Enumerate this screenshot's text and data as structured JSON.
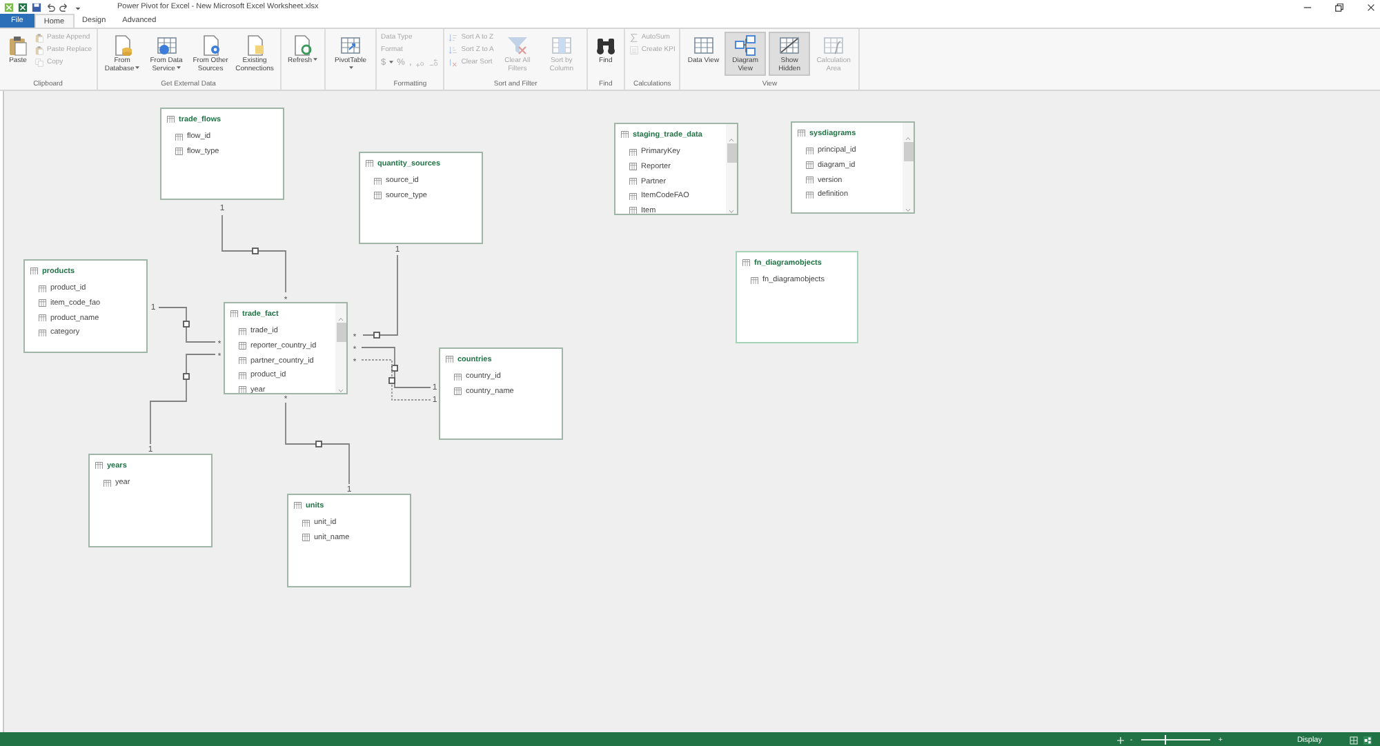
{
  "window": {
    "title": "Power Pivot for Excel - New Microsoft Excel Worksheet.xlsx"
  },
  "ribbon_tabs": [
    {
      "label": "File",
      "kind": "file",
      "selected": false
    },
    {
      "label": "Home",
      "kind": "tab",
      "selected": true
    },
    {
      "label": "Design",
      "kind": "tab",
      "selected": false
    },
    {
      "label": "Advanced",
      "kind": "tab",
      "selected": false
    }
  ],
  "ribbon_groups": [
    {
      "label": "Clipboard",
      "items": [
        {
          "kind": "large",
          "label": "Paste",
          "dropdown": false,
          "disabled": false,
          "selected": false
        },
        {
          "kind": "small",
          "label": "Paste Append",
          "dropdown": false,
          "disabled": true,
          "selected": false
        },
        {
          "kind": "small",
          "label": "Paste Replace",
          "dropdown": false,
          "disabled": true,
          "selected": false
        },
        {
          "kind": "small",
          "label": "Copy",
          "dropdown": false,
          "disabled": true,
          "selected": false
        }
      ]
    },
    {
      "label": "Get External Data",
      "items": [
        {
          "kind": "large",
          "label": "From Database",
          "dropdown": true,
          "disabled": false,
          "selected": false
        },
        {
          "kind": "large",
          "label": "From Data Service",
          "dropdown": true,
          "disabled": false,
          "selected": false
        },
        {
          "kind": "large",
          "label": "From Other Sources",
          "dropdown": false,
          "disabled": false,
          "selected": false
        },
        {
          "kind": "large",
          "label": "Existing Connections",
          "dropdown": false,
          "disabled": false,
          "selected": false
        }
      ]
    },
    {
      "items": [
        {
          "kind": "large",
          "label": "Refresh",
          "dropdown": true,
          "disabled": false,
          "selected": false
        }
      ]
    },
    {
      "items": [
        {
          "kind": "large",
          "label": "PivotTable",
          "dropdown": true,
          "disabled": false,
          "selected": false
        }
      ]
    },
    {
      "label": "Formatting",
      "items": [
        {
          "kind": "small",
          "label": "Data Type",
          "dropdown": false,
          "disabled": true,
          "selected": false
        },
        {
          "kind": "small",
          "label": "Format",
          "dropdown": false,
          "disabled": true,
          "selected": false
        },
        {
          "kind": "symbol",
          "label": "$",
          "dropdown": true,
          "disabled": true,
          "selected": false
        },
        {
          "kind": "symbol",
          "label": "%",
          "dropdown": false,
          "disabled": true,
          "selected": false
        },
        {
          "kind": "symbol",
          "label": ",",
          "dropdown": false,
          "disabled": true,
          "selected": false
        },
        {
          "kind": "icon",
          "dropdown": false,
          "disabled": true,
          "selected": false
        },
        {
          "kind": "icon",
          "dropdown": false,
          "disabled": true,
          "selected": false
        }
      ]
    },
    {
      "label": "Sort and Filter",
      "items": [
        {
          "kind": "small",
          "label": "Sort A to Z",
          "dropdown": false,
          "disabled": true,
          "selected": false
        },
        {
          "kind": "small",
          "label": "Sort Z to A",
          "dropdown": false,
          "disabled": true,
          "selected": false
        },
        {
          "kind": "small",
          "label": "Clear Sort",
          "dropdown": false,
          "disabled": true,
          "selected": false
        },
        {
          "kind": "large",
          "label": "Clear All Filters",
          "dropdown": false,
          "disabled": true,
          "selected": false
        },
        {
          "kind": "large",
          "label": "Sort by Column",
          "dropdown": false,
          "disabled": true,
          "selected": false
        }
      ]
    },
    {
      "label": "Find",
      "items": [
        {
          "kind": "large",
          "label": "Find",
          "dropdown": false,
          "disabled": false,
          "selected": false
        }
      ]
    },
    {
      "label": "Calculations",
      "items": [
        {
          "kind": "small",
          "label": "AutoSum",
          "dropdown": false,
          "disabled": true,
          "selected": false
        },
        {
          "kind": "small",
          "label": "Create KPI",
          "dropdown": false,
          "disabled": true,
          "selected": false
        }
      ]
    },
    {
      "label": "View",
      "items": [
        {
          "kind": "large",
          "label": "Data View",
          "dropdown": false,
          "disabled": false,
          "selected": false
        },
        {
          "kind": "large",
          "label": "Diagram View",
          "dropdown": false,
          "disabled": false,
          "selected": true
        },
        {
          "kind": "large",
          "label": "Show Hidden",
          "dropdown": false,
          "disabled": false,
          "selected": true
        },
        {
          "kind": "large",
          "label": "Calculation Area",
          "dropdown": false,
          "disabled": true,
          "selected": false
        }
      ]
    }
  ],
  "tables": [
    {
      "name": "trade_flows",
      "selected": false,
      "scrollable": false,
      "fields": [
        "flow_id",
        "flow_type"
      ]
    },
    {
      "name": "quantity_sources",
      "selected": false,
      "scrollable": false,
      "fields": [
        "source_id",
        "source_type"
      ]
    },
    {
      "name": "staging_trade_data",
      "selected": false,
      "scrollable": true,
      "fields": [
        "PrimaryKey",
        "Reporter",
        "Partner",
        "ItemCodeFAO",
        "Item"
      ]
    },
    {
      "name": "sysdiagrams",
      "selected": false,
      "scrollable": true,
      "fields": [
        "principal_id",
        "diagram_id",
        "version",
        "definition"
      ]
    },
    {
      "name": "products",
      "selected": false,
      "scrollable": false,
      "fields": [
        "product_id",
        "item_code_fao",
        "product_name",
        "category"
      ]
    },
    {
      "name": "fn_diagramobjects",
      "selected": true,
      "scrollable": false,
      "fields": [
        "fn_diagramobjects"
      ]
    },
    {
      "name": "trade_fact",
      "selected": false,
      "scrollable": true,
      "fields": [
        "trade_id",
        "reporter_country_id",
        "partner_country_id",
        "product_id",
        "year"
      ]
    },
    {
      "name": "countries",
      "selected": false,
      "scrollable": false,
      "fields": [
        "country_id",
        "country_name"
      ]
    },
    {
      "name": "years",
      "selected": false,
      "scrollable": false,
      "fields": [
        "year"
      ]
    },
    {
      "name": "units",
      "selected": false,
      "scrollable": false,
      "fields": [
        "unit_id",
        "unit_name"
      ]
    }
  ],
  "relationships": [
    {
      "one": "1",
      "many": "*",
      "active": true
    },
    {
      "one": "1",
      "many": "*",
      "active": true
    },
    {
      "one": "1",
      "many": "*",
      "active": true
    },
    {
      "one": "1",
      "many": "*",
      "active": true
    },
    {
      "one": "1",
      "many": "*",
      "active": true
    },
    {
      "one": "1",
      "many": "*",
      "active": false
    },
    {
      "one": "1",
      "many": "*",
      "active": true
    }
  ],
  "status_bar": {
    "zoom_out": "-",
    "zoom_in": "+",
    "zoom": {
      "level": 0.35
    },
    "display_label": "Display"
  }
}
